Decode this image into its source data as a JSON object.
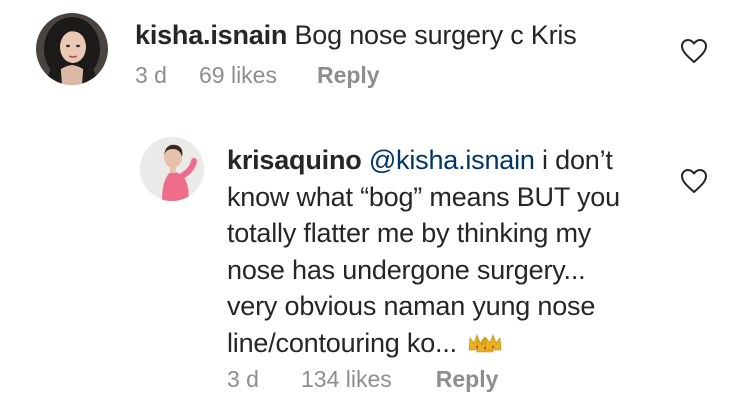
{
  "comment": {
    "username": "kisha.isnain",
    "text": "Bog nose surgery c Kris",
    "time": "3 d",
    "likes": "69 likes",
    "reply_label": "Reply",
    "avatar_icon": "profile-photo-woman-dark-hair",
    "heart_icon": "heart-outline-icon"
  },
  "reply": {
    "username": "krisaquino",
    "mention": "@kisha.isnain",
    "lines": [
      "i don’t",
      "know what “bog” means BUT you",
      "totally flatter me by thinking my",
      "nose has undergone surgery...",
      "very obvious naman yung nose",
      "line/contouring ko..."
    ],
    "emoji": "👑👑👑",
    "time": "3 d",
    "likes": "134 likes",
    "reply_label": "Reply",
    "avatar_icon": "profile-photo-woman-pink-top",
    "heart_icon": "heart-outline-icon"
  },
  "colors": {
    "text": "#262626",
    "meta": "#8e8e8e",
    "mention": "#003569",
    "crown": "#e8b21f"
  }
}
